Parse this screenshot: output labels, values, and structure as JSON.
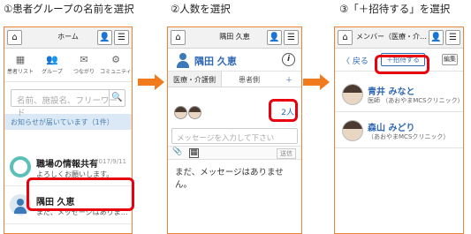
{
  "steps": [
    {
      "title": "①患者グループの名前を選択"
    },
    {
      "title": "②人数を選択"
    },
    {
      "title": "③「＋招待する」を選択"
    }
  ],
  "panel1": {
    "header_title": "ホーム",
    "grid_items": [
      "患者リスト",
      "グループ",
      "つながり",
      "コミュニティ"
    ],
    "search_placeholder": "名前、施設名、フリーワード",
    "notice": "お知らせが届いています（1件）",
    "groups": [
      {
        "name": "職場の情報共有",
        "sub": "よろしくお願いします。",
        "date": "2017/9/11"
      },
      {
        "name": "隅田 久恵",
        "sub": "まだ、メッセージはありま…"
      }
    ]
  },
  "panel2": {
    "header_title": "隅田 久恵",
    "patient_name": "隅田 久恵",
    "tabs": [
      "医療・介護側",
      "患者側"
    ],
    "tab_add": "＋",
    "count": "2人",
    "message_placeholder": "メッセージを入力して下さい",
    "send_label": "送信",
    "empty_message": "まだ、メッセージはありません。"
  },
  "panel3": {
    "header_title": "メンバー（医療・介…",
    "back_label": "〈 戻る",
    "invite_label": "＋招待する",
    "edit_label": "編集",
    "members": [
      {
        "name": "青井 みなと",
        "role": "医師 （あおやまMCSクリニック）"
      },
      {
        "name": "森山 みどり",
        "role": "（あおやまMCSクリニック）"
      }
    ]
  },
  "colors": {
    "accent": "#2f67b2",
    "highlight": "#e8000e",
    "arrow": "#f07a1c",
    "border": "#e8853a"
  }
}
